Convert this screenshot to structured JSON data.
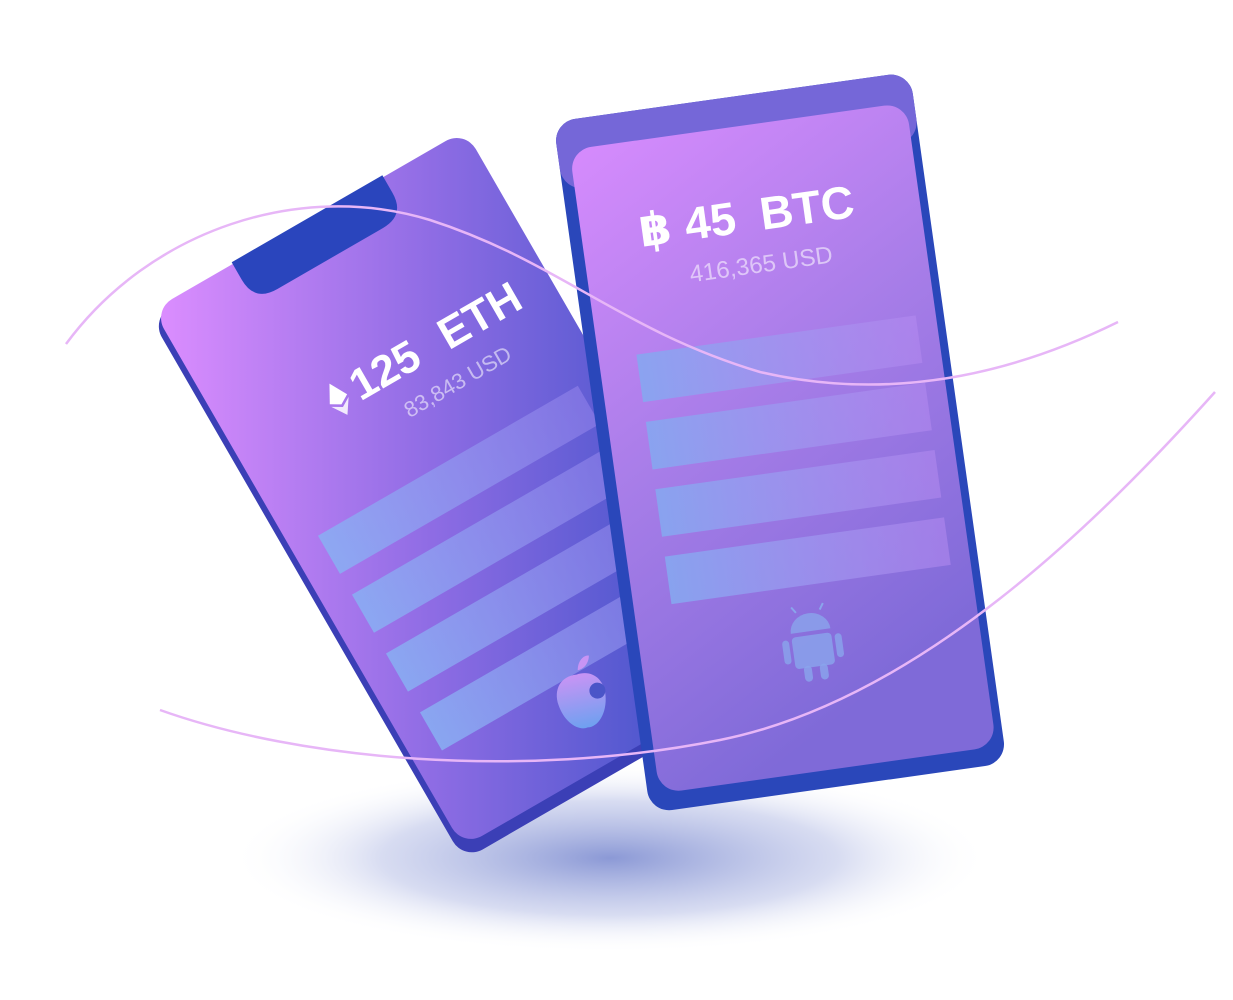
{
  "eth_card": {
    "amount": "125",
    "currency": "ETH",
    "usd_value": "83,843 USD",
    "platform_icon": "apple-icon",
    "currency_icon": "ethereum-icon"
  },
  "btc_card": {
    "symbol": "฿",
    "amount": "45",
    "currency": "BTC",
    "usd_value": "416,365 USD",
    "platform_icon": "android-icon"
  },
  "colors": {
    "gradient_top": "#d48bff",
    "gradient_mid": "#9b6fe6",
    "gradient_bottom": "#2f47bf",
    "frame": "#2741b8",
    "bar": "#7fa0ee",
    "curve": "#e7b6f7",
    "shadow": "#6a7ccc"
  }
}
